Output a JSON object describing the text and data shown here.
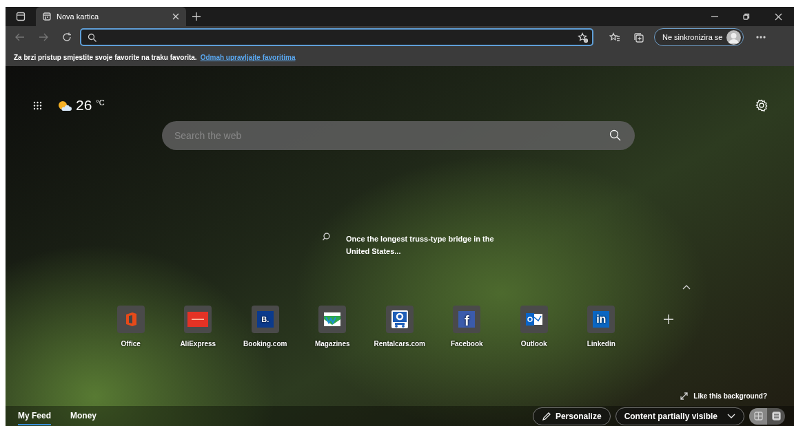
{
  "tabs": [
    {
      "title": "Nova kartica",
      "selected": true
    }
  ],
  "profile": {
    "label": "Ne sinkronizira se"
  },
  "favorites_bar": {
    "message": "Za brzi pristup smjestite svoje favorite na traku favorita.",
    "link": "Odmah upravljajte favoritima"
  },
  "weather": {
    "temperature": "26",
    "unit": "°C"
  },
  "search": {
    "placeholder": "Search the web"
  },
  "image_caption": "Once the longest truss-type bridge in the United States...",
  "quick_links": [
    {
      "label": "Office",
      "kind": "office"
    },
    {
      "label": "AliExpress",
      "kind": "aliexpress"
    },
    {
      "label": "Booking.com",
      "kind": "booking",
      "logo_text": "B."
    },
    {
      "label": "Magazines",
      "kind": "magazines"
    },
    {
      "label": "Rentalcars.com",
      "kind": "rentalcars"
    },
    {
      "label": "Facebook",
      "kind": "facebook",
      "logo_text": "f"
    },
    {
      "label": "Outlook",
      "kind": "outlook"
    },
    {
      "label": "Linkedin",
      "kind": "linkedin",
      "logo_text": "in"
    }
  ],
  "like_background": "Like this background?",
  "feed_tabs": [
    {
      "label": "My Feed",
      "selected": true
    },
    {
      "label": "Money",
      "selected": false
    }
  ],
  "personalize": "Personalize",
  "content_visibility": "Content partially visible",
  "layout_toggle": [
    {
      "kind": "grid",
      "selected": true
    },
    {
      "kind": "list",
      "selected": false
    }
  ]
}
